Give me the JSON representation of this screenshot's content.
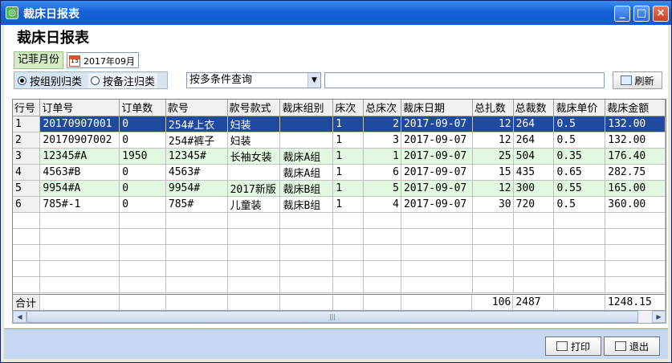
{
  "window": {
    "title": "裁床日报表",
    "app_icon": "app-icon"
  },
  "page": {
    "title": "裁床日报表"
  },
  "filters": {
    "month_label": "记菲月份",
    "month_value": "2017年09月",
    "radio_group": "按组别归类",
    "radio_remark": "按备注归类",
    "query_select": "按多条件查询",
    "query_input": "",
    "refresh_label": "刷新"
  },
  "table": {
    "columns": [
      "行号",
      "订单号",
      "订单数",
      "款号",
      "款号款式",
      "裁床组别",
      "床次",
      "总床次",
      "裁床日期",
      "总扎数",
      "总裁数",
      "裁床单价",
      "裁床金额"
    ],
    "rows": [
      [
        "1",
        "20170907001",
        "0",
        "254#上衣",
        "妇装",
        "",
        "1",
        "2",
        "2017-09-07",
        "12",
        "264",
        "0.5",
        "132.00"
      ],
      [
        "2",
        "20170907002",
        "0",
        "254#裤子",
        "妇装",
        "",
        "1",
        "3",
        "2017-09-07",
        "12",
        "264",
        "0.5",
        "132.00"
      ],
      [
        "3",
        "12345#A",
        "1950",
        "12345#",
        "长袖女装",
        "裁床A组",
        "1",
        "1",
        "2017-09-07",
        "25",
        "504",
        "0.35",
        "176.40"
      ],
      [
        "4",
        "4563#B",
        "0",
        "4563#",
        "",
        "裁床A组",
        "1",
        "6",
        "2017-09-07",
        "15",
        "435",
        "0.65",
        "282.75"
      ],
      [
        "5",
        "9954#A",
        "0",
        "9954#",
        "2017新版",
        "裁床B组",
        "1",
        "5",
        "2017-09-07",
        "12",
        "300",
        "0.55",
        "165.00"
      ],
      [
        "6",
        "785#-1",
        "0",
        "785#",
        "儿童装",
        "裁床B组",
        "1",
        "4",
        "2017-09-07",
        "30",
        "720",
        "0.5",
        "360.00"
      ]
    ],
    "footer": {
      "label": "合计",
      "total_bundles": "106",
      "total_cut": "2487",
      "total_amount": "1248.15"
    }
  },
  "buttons": {
    "print": "打印",
    "exit": "退出"
  }
}
